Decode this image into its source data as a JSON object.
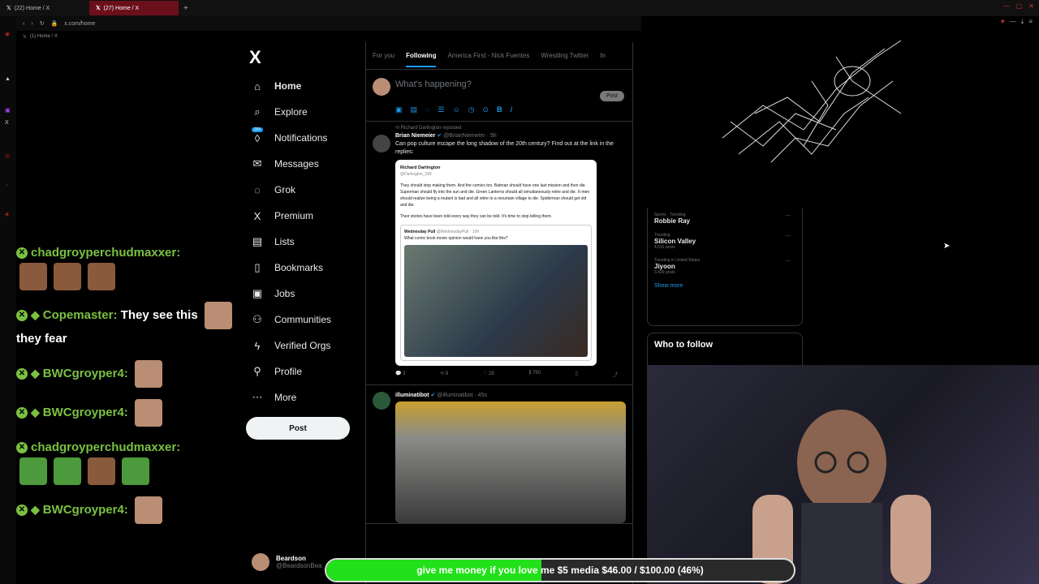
{
  "browser": {
    "tabs": [
      {
        "label": "(22) Home / X",
        "active": false
      },
      {
        "label": "(27) Home / X",
        "active": true
      }
    ],
    "url": "x.com/home",
    "bookmark": "(1) Home / X"
  },
  "chat": {
    "messages": [
      {
        "user": "chadgroyperchudmaxxer:",
        "text": ""
      },
      {
        "user": "Copemaster:",
        "text": "They see this",
        "text2": "they fear"
      },
      {
        "user": "BWCgroyper4:",
        "text": ""
      },
      {
        "user": "BWCgroyper4:",
        "text": ""
      },
      {
        "user": "chadgroyperchudmaxxer:",
        "text": ""
      },
      {
        "user": "BWCgroyper4:",
        "text": ""
      }
    ]
  },
  "nav": {
    "logo": "X",
    "items": [
      {
        "label": "Home",
        "icon": "home-icon",
        "glyph": "⌂"
      },
      {
        "label": "Explore",
        "icon": "search-icon",
        "glyph": "⌕"
      },
      {
        "label": "Notifications",
        "icon": "bell-icon",
        "glyph": "🔔"
      },
      {
        "label": "Messages",
        "icon": "envelope-icon",
        "glyph": "✉"
      },
      {
        "label": "Grok",
        "icon": "grok-icon",
        "glyph": "◌"
      },
      {
        "label": "Premium",
        "icon": "x-icon",
        "glyph": "X"
      },
      {
        "label": "Lists",
        "icon": "list-icon",
        "glyph": "▤"
      },
      {
        "label": "Bookmarks",
        "icon": "bookmark-icon",
        "glyph": "▯"
      },
      {
        "label": "Jobs",
        "icon": "briefcase-icon",
        "glyph": "▣"
      },
      {
        "label": "Communities",
        "icon": "people-icon",
        "glyph": "⚇"
      },
      {
        "label": "Verified Orgs",
        "icon": "lightning-icon",
        "glyph": "ϟ"
      },
      {
        "label": "Profile",
        "icon": "person-icon",
        "glyph": "⚲"
      },
      {
        "label": "More",
        "icon": "more-icon",
        "glyph": "⋯"
      }
    ],
    "notif_count": "20+",
    "post_label": "Post",
    "account_name": "Beardson",
    "account_handle": "@BeardsonBea"
  },
  "timeline": {
    "tabs": [
      "For you",
      "Following",
      "America First - Nick Fuentes",
      "Wrestling Twitter",
      "In"
    ],
    "placeholder": "What's happening?",
    "post_label": "Post",
    "tweet1": {
      "repost": "Richard Darlington reposted",
      "name": "Brian Niemeier",
      "handle": "@BrianNiemeier · 5h",
      "text": "Can pop culture escape the long shadow of the 20th century? Find out at the link in the replies:",
      "quote_name": "Richard Darlington",
      "quote_handle": "@Darlington_SW",
      "quote_text1": "They should stop making them. And the comics too. Batman should have one last mission and then die. Superman should fly into the sun and die. Green Lanterns should all simultaneously retire and die. X-men should realize being a mutant is bad and all retire to a mountain village to die. Spiderman should get old and die.",
      "quote_text2": "Their stories have been told every way they can be told. It's time to stop telling them.",
      "inner_name": "Wednesday Pull",
      "inner_handle": "@WednesdayPull · 10h",
      "inner_text": "What comic book movie opinion would have you like this?",
      "replies": "3",
      "reposts": "8",
      "likes": "28",
      "views": "790"
    },
    "tweet2": {
      "name": "illuminatibot",
      "handle": "@illuminatibot · 45s"
    }
  },
  "trends": [
    {
      "context": "Sports · Trending",
      "name": "Robbie Ray",
      "count": ""
    },
    {
      "context": "Trending",
      "name": "Silicon Valley",
      "count": "4,631 posts"
    },
    {
      "context": "Trending in United States",
      "name": "Jiyoon",
      "count": "3,429 posts"
    }
  ],
  "show_more": "Show more",
  "who_to_follow": "Who to follow",
  "goal": {
    "label": "give me money if you love me $5 media $46.00 / $100.00 (46%)",
    "progress": 0.46
  }
}
